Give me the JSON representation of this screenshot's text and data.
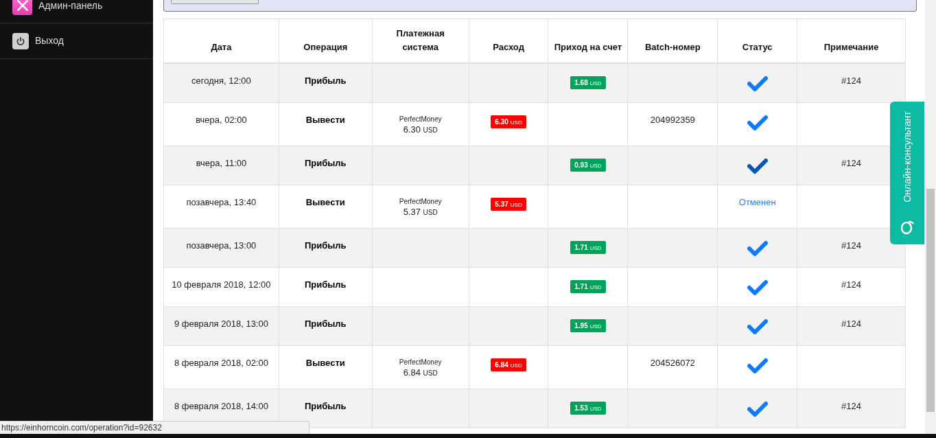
{
  "sidebar": {
    "items": [
      {
        "label": "Админ-панель",
        "kind": "admin"
      },
      {
        "label": "Выход",
        "kind": "logout"
      }
    ]
  },
  "table": {
    "columns": [
      "Дата",
      "Операция",
      "Платежная система",
      "Расход",
      "Приход на счет",
      "Batch-номер",
      "Статус",
      "Примечание"
    ],
    "rows": [
      {
        "date": "сегодня, 12:00",
        "operation": "Прибыль",
        "income": {
          "amount": "1.68",
          "unit": "USD"
        },
        "status": {
          "kind": "done",
          "hovered": false
        },
        "note": "#124"
      },
      {
        "date": "вчера, 02:00",
        "operation": "Вывести",
        "payment": {
          "system": "PerfectMoney",
          "amount": "6.30",
          "unit": "USD"
        },
        "expense": {
          "amount": "6.30",
          "unit": "USD"
        },
        "batch": "204992359",
        "status": {
          "kind": "done",
          "hovered": false
        }
      },
      {
        "date": "вчера, 11:00",
        "operation": "Прибыль",
        "income": {
          "amount": "0.93",
          "unit": "USD"
        },
        "status": {
          "kind": "done",
          "hovered": true
        },
        "note": "#124"
      },
      {
        "date": "позавчера, 13:40",
        "operation": "Вывести",
        "payment": {
          "system": "PerfectMoney",
          "amount": "5.37",
          "unit": "USD"
        },
        "expense": {
          "amount": "5.37",
          "unit": "USD"
        },
        "status": {
          "kind": "cancelled",
          "label": "Отменен",
          "hovered": false
        }
      },
      {
        "date": "позавчера, 13:00",
        "operation": "Прибыль",
        "income": {
          "amount": "1.71",
          "unit": "USD"
        },
        "status": {
          "kind": "done",
          "hovered": false
        },
        "note": "#124"
      },
      {
        "date": "10 февраля 2018, 12:00",
        "operation": "Прибыль",
        "income": {
          "amount": "1.71",
          "unit": "USD"
        },
        "status": {
          "kind": "done",
          "hovered": false
        },
        "note": "#124"
      },
      {
        "date": "9 февраля 2018, 13:00",
        "operation": "Прибыль",
        "income": {
          "amount": "1.95",
          "unit": "USD"
        },
        "status": {
          "kind": "done",
          "hovered": false
        },
        "note": "#124"
      },
      {
        "date": "8 февраля 2018, 02:00",
        "operation": "Вывести",
        "payment": {
          "system": "PerfectMoney",
          "amount": "6.84",
          "unit": "USD"
        },
        "expense": {
          "amount": "6.84",
          "unit": "USD"
        },
        "batch": "204526072",
        "status": {
          "kind": "done",
          "hovered": false
        }
      },
      {
        "date": "8 февраля 2018, 14:00",
        "operation": "Прибыль",
        "income": {
          "amount": "1.53",
          "unit": "USD"
        },
        "status": {
          "kind": "done",
          "hovered": false
        },
        "note": "#124"
      }
    ]
  },
  "chat_tab": {
    "label": "Онлайн-консультант"
  },
  "status_bar": {
    "url": "https://einhorncoin.com/operation?id=92632"
  }
}
